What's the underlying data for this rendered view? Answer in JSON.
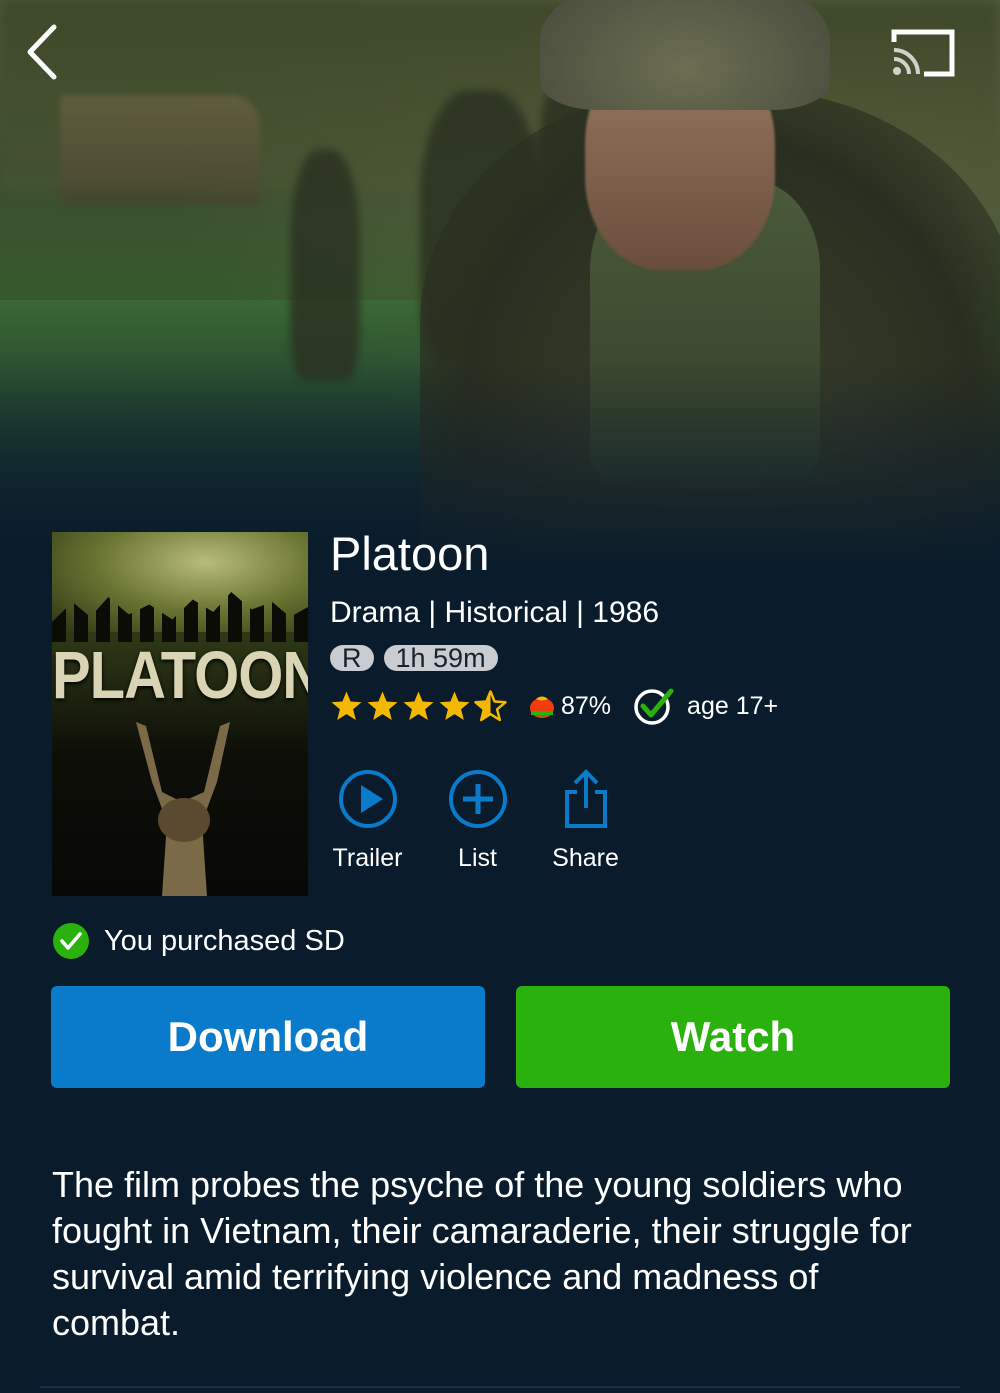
{
  "header": {
    "back_icon": "chevron-left-icon",
    "cast_icon": "cast-icon"
  },
  "movie": {
    "title": "Platoon",
    "poster_title": "PLATOON",
    "meta": "Drama | Historical | 1986",
    "mpaa_rating": "R",
    "runtime": "1h 59m",
    "star_rating": 4.5,
    "star_max": 5,
    "tomatometer": "87%",
    "age_rating": "age 17+",
    "description": "The film probes the psyche of the young soldiers who fought in Vietnam, their camaraderie, their struggle for survival amid terrifying violence and madness of combat."
  },
  "actions": {
    "trailer_label": "Trailer",
    "list_label": "List",
    "share_label": "Share"
  },
  "purchase": {
    "status_text": "You purchased SD"
  },
  "buttons": {
    "download_label": "Download",
    "watch_label": "Watch"
  },
  "colors": {
    "background": "#0a1c2c",
    "accent_blue": "#0a7bcb",
    "accent_green": "#2ab10e",
    "star": "#f5b800",
    "check_green": "#2ab10e"
  }
}
